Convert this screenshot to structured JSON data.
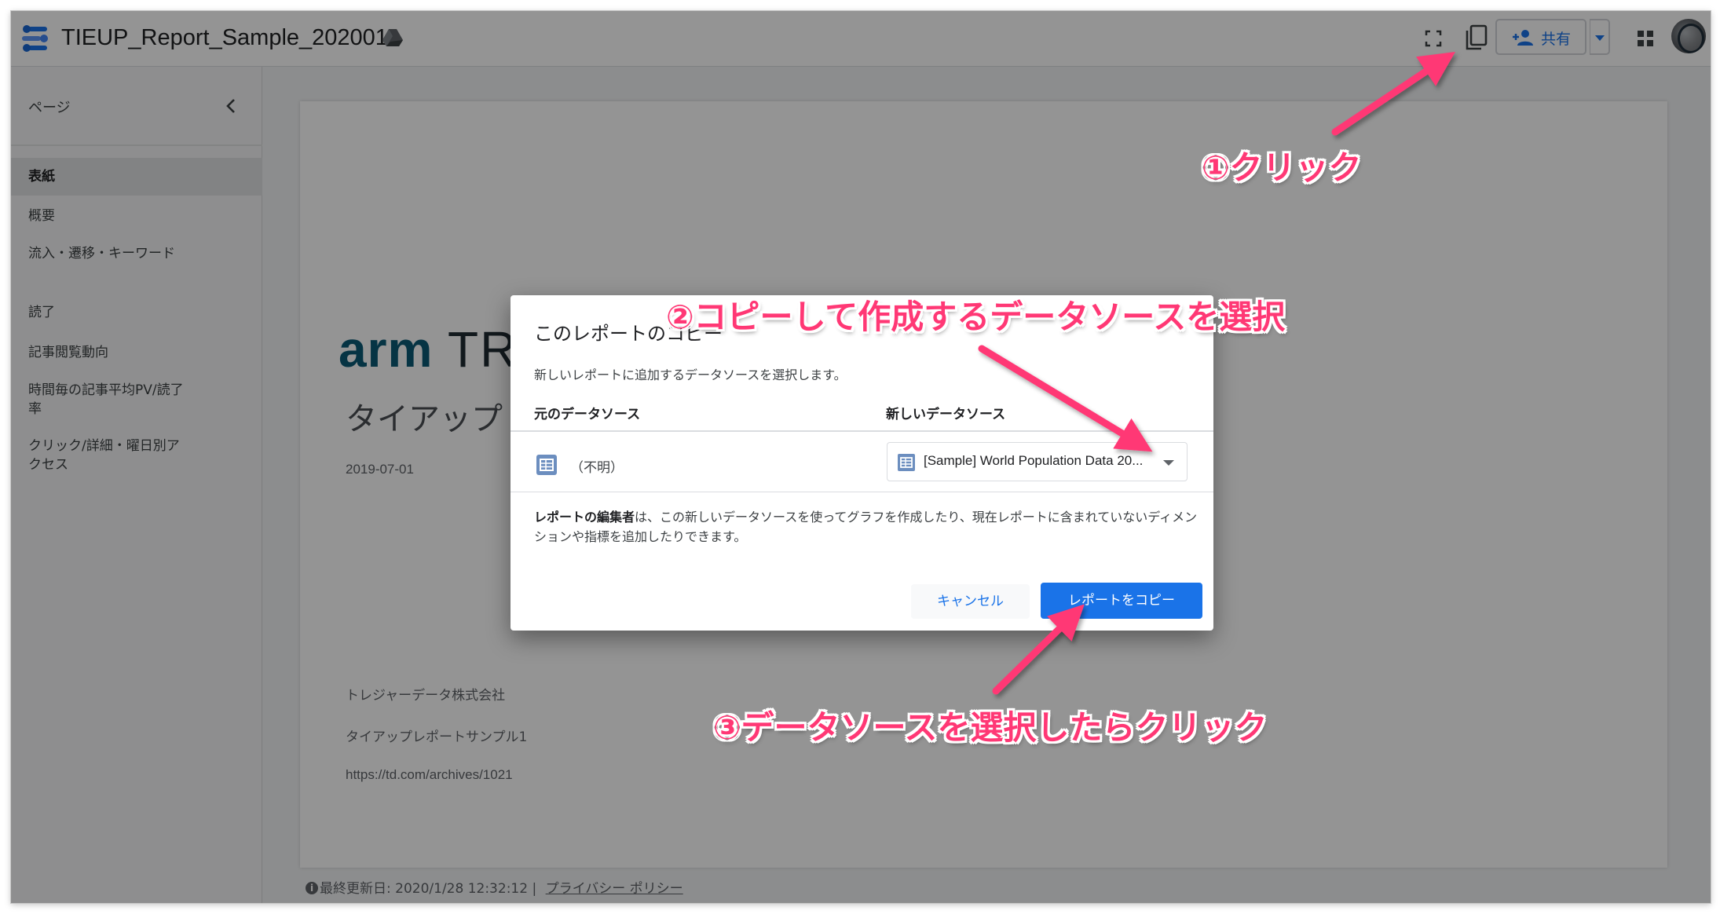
{
  "header": {
    "title": "TIEUP_Report_Sample_202001",
    "share_label": "共有"
  },
  "sidebar": {
    "title": "ページ",
    "items": [
      {
        "label": "表紙",
        "active": true
      },
      {
        "label": "概要"
      },
      {
        "label": "流入・遷移・キーワード"
      },
      {
        "label": "読了"
      },
      {
        "label": "記事閲覧動向"
      },
      {
        "label": "時間毎の記事平均PV/読了率"
      },
      {
        "label": "クリック/詳細・曜日別アクセス"
      }
    ]
  },
  "report": {
    "logo_part1": "arm",
    "logo_part2": " TRE",
    "title": "タイアップ",
    "date": "2019-07-01",
    "company": "トレジャーデータ株式会社",
    "subtitle": "タイアップレポートサンプル1",
    "url": "https://td.com/archives/1021"
  },
  "footer": {
    "last_updated": "最終更新日: 2020/1/28 12:32:12",
    "privacy": "プライバシー ポリシー"
  },
  "dialog": {
    "title": "このレポートのコピー",
    "description": "新しいレポートに追加するデータソースを選択します。",
    "col_original": "元のデータソース",
    "col_new": "新しいデータソース",
    "original_source": "（不明）",
    "new_source": "[Sample] World Population Data 20...",
    "note_bold": "レポートの編集者",
    "note_rest": "は、この新しいデータソースを使ってグラフを作成したり、現在レポートに含まれていないディメンションや指標を追加したりできます。",
    "cancel_label": "キャンセル",
    "copy_label": "レポートをコピー"
  },
  "annotations": {
    "step1": "①クリック",
    "step2": "②コピーして作成するデータソースを選択",
    "step3": "③データソースを選択したらクリック"
  },
  "colors": {
    "annotation": "#ff3875",
    "accent": "#1a73e8",
    "brand": "#0b5a75"
  },
  "icons": [
    "data-studio-logo",
    "drive-icon",
    "fullscreen-icon",
    "copy-icon",
    "add-person-icon",
    "apps-grid-icon",
    "chevron-left-icon",
    "table-icon",
    "info-icon"
  ]
}
